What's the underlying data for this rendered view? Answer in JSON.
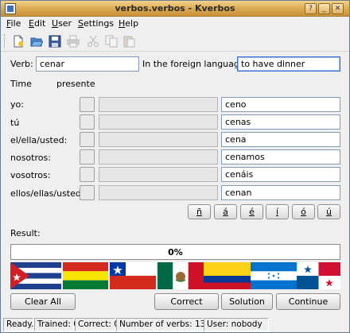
{
  "window": {
    "title": "verbos.verbos - Kverbos"
  },
  "menu": [
    {
      "label": "File",
      "u": "F",
      "rest": "ile"
    },
    {
      "label": "Edit",
      "u": "E",
      "rest": "dit"
    },
    {
      "label": "User",
      "u": "U",
      "rest": "ser"
    },
    {
      "label": "Settings",
      "u": "S",
      "rest": "ettings"
    },
    {
      "label": "Help",
      "u": "H",
      "rest": "elp"
    }
  ],
  "toolbar": {
    "icons": [
      "new-icon",
      "open-icon",
      "save-icon",
      "print-icon",
      "cut-icon",
      "copy-icon",
      "paste-icon"
    ]
  },
  "form": {
    "verb_label": "Verb:",
    "verb_value": "cenar",
    "foreign_label": "In the foreign language:",
    "foreign_value": "to have dinner",
    "time_label": "Time",
    "time_value": "presente"
  },
  "rows": [
    {
      "pronoun": "yo:",
      "answer": "ceno"
    },
    {
      "pronoun": "tú",
      "answer": "cenas"
    },
    {
      "pronoun": "el/ella/usted:",
      "answer": "cena"
    },
    {
      "pronoun": "nosotros:",
      "answer": "cenamos"
    },
    {
      "pronoun": "vosotros:",
      "answer": "cenáis"
    },
    {
      "pronoun": "ellos/ellas/ustede",
      "answer": "cenan"
    }
  ],
  "accents": [
    "ñ",
    "á",
    "é",
    "í",
    "ó",
    "ú"
  ],
  "result": {
    "label": "Result:",
    "progress_text": "0%",
    "progress_fraction": 0.0
  },
  "flags": [
    "Cuba",
    "Bolivia",
    "Chile",
    "Mexico",
    "Colombia",
    "Honduras",
    "Panama"
  ],
  "buttons": {
    "clear_all": "Clear All",
    "correct": "Correct",
    "solution": "Solution",
    "continue": "Continue"
  },
  "status": {
    "state": "Ready.",
    "trained": "Trained: 0",
    "correct": "Correct: 0",
    "verbs": "Number of verbs: 137",
    "user": "User: nobody"
  }
}
